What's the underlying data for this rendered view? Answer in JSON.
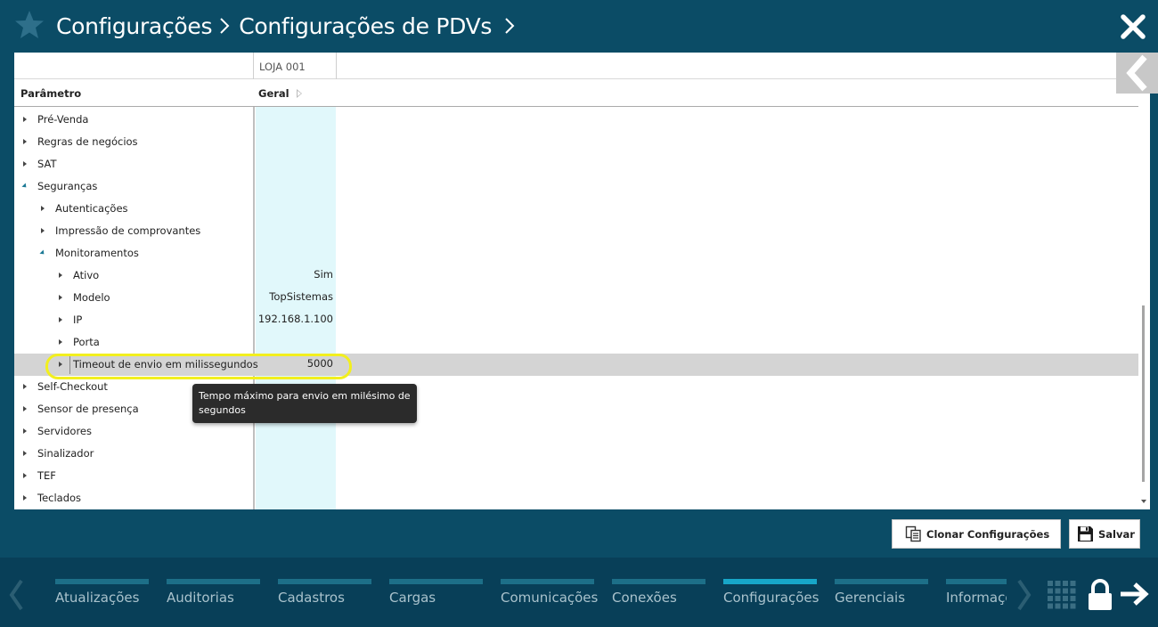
{
  "header": {
    "breadcrumb": [
      "Configurações",
      "Configurações de PDVs"
    ],
    "icons": [
      "star-icon",
      "chevron-right-icon",
      "close-icon"
    ]
  },
  "grid": {
    "store_column": "LOJA 001",
    "param_header": "Parâmetro",
    "group_header": "Geral",
    "rows": [
      {
        "label": "Pré-Venda",
        "level": 0,
        "expanded": false,
        "value": ""
      },
      {
        "label": "Regras de negócios",
        "level": 0,
        "expanded": false,
        "value": ""
      },
      {
        "label": "SAT",
        "level": 0,
        "expanded": false,
        "value": ""
      },
      {
        "label": "Seguranças",
        "level": 0,
        "expanded": true,
        "value": ""
      },
      {
        "label": "Autenticações",
        "level": 1,
        "expanded": false,
        "value": ""
      },
      {
        "label": "Impressão de comprovantes",
        "level": 1,
        "expanded": false,
        "value": ""
      },
      {
        "label": "Monitoramentos",
        "level": 1,
        "expanded": true,
        "value": ""
      },
      {
        "label": "Ativo",
        "level": 2,
        "expanded": false,
        "value": "Sim"
      },
      {
        "label": "Modelo",
        "level": 2,
        "expanded": false,
        "value": "TopSistemas"
      },
      {
        "label": "IP",
        "level": 2,
        "expanded": false,
        "value": "192.168.1.100"
      },
      {
        "label": "Porta",
        "level": 2,
        "expanded": false,
        "value": ""
      },
      {
        "label": "Timeout de envio em milissegundos",
        "level": 2,
        "expanded": false,
        "value": "5000",
        "selected": true
      },
      {
        "label": "Self-Checkout",
        "level": 0,
        "expanded": false,
        "value": ""
      },
      {
        "label": "Sensor de presença",
        "level": 0,
        "expanded": false,
        "value": ""
      },
      {
        "label": "Servidores",
        "level": 0,
        "expanded": false,
        "value": ""
      },
      {
        "label": "Sinalizador",
        "level": 0,
        "expanded": false,
        "value": ""
      },
      {
        "label": "TEF",
        "level": 0,
        "expanded": false,
        "value": ""
      },
      {
        "label": "Teclados",
        "level": 0,
        "expanded": false,
        "value": ""
      }
    ],
    "tooltip": "Tempo máximo para envio em milésimo de segundos"
  },
  "actions": {
    "clone_label": "Clonar Configurações",
    "save_label": "Salvar"
  },
  "bottom_nav": {
    "tabs": [
      "Atualizações",
      "Auditorias",
      "Cadastros",
      "Cargas",
      "Comunicações",
      "Conexões",
      "Configurações",
      "Gerenciais",
      "Informações"
    ],
    "active_tab": "Configurações"
  },
  "colors": {
    "header_bg": "#0b4c66",
    "accent": "#17a6c8",
    "highlight": "#f2ef1e",
    "value_column_bg": "#e1f8fb"
  }
}
